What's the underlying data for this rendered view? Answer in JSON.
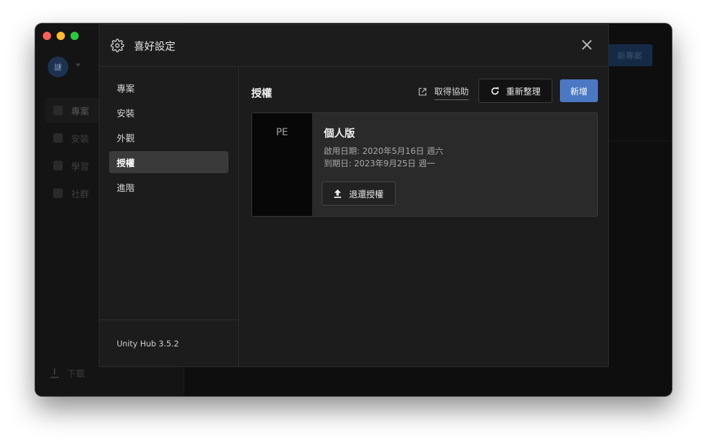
{
  "background": {
    "avatar_initial": "謎",
    "nav_items": [
      "專案",
      "安裝",
      "學習",
      "社群"
    ],
    "download_label": "下載",
    "new_project_label": "新專案"
  },
  "modal": {
    "title": "喜好設定",
    "sidebar": {
      "items": [
        {
          "label": "專案"
        },
        {
          "label": "安裝"
        },
        {
          "label": "外觀"
        },
        {
          "label": "授權"
        },
        {
          "label": "進階"
        }
      ],
      "active": "授權",
      "version": "Unity Hub 3.5.2"
    },
    "content": {
      "title": "授權",
      "help_label": "取得協助",
      "refresh_label": "重新整理",
      "add_label": "新增",
      "license": {
        "badge": "PE",
        "name": "個人版",
        "activated": "啟用日期: 2020年5月16日 週六",
        "expires": "到期日: 2023年9月25日 週一",
        "return_label": "退還授權"
      }
    }
  },
  "colors": {
    "accent": "#4a78c2",
    "window_bg": "#0e0e0e",
    "modal_bg": "#1c1c1c"
  },
  "icons": [
    "gear-icon",
    "close-icon",
    "external-link-icon",
    "refresh-icon",
    "upload-icon"
  ]
}
